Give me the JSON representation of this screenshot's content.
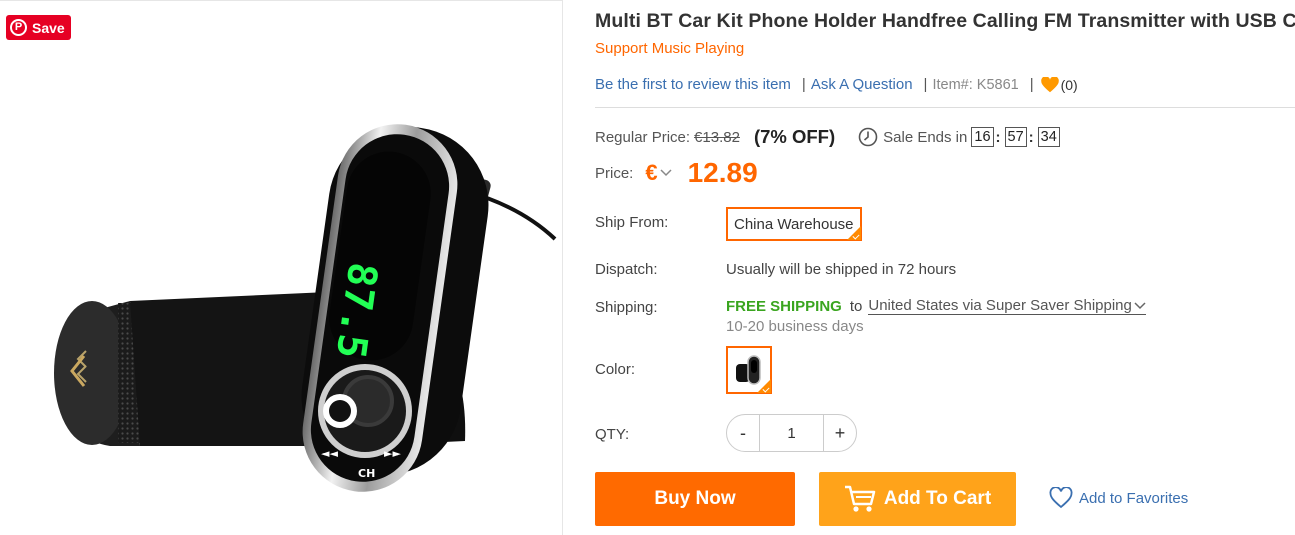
{
  "pinterest": {
    "save_label": "Save",
    "icon": "pinterest-icon"
  },
  "product": {
    "title": "Multi BT Car Kit Phone Holder Handfree Calling FM Transmitter with USB Charger",
    "subtitle": "Support Music Playing",
    "review_link": "Be the first to review this item",
    "ask_link": "Ask A Question",
    "item_number": "Item#: K5861",
    "favorites_count": "(0)",
    "display_digits": "87.5"
  },
  "pricing": {
    "regular_label": "Regular Price:",
    "regular_price": "€13.82",
    "discount": "(7% OFF)",
    "sale_label": "Sale Ends in",
    "timer": {
      "hours": "16",
      "minutes": "57",
      "seconds": "34"
    },
    "price_label": "Price:",
    "currency": "€",
    "price": "12.89"
  },
  "options": {
    "ship_from_label": "Ship From:",
    "ship_from_value": "China Warehouse",
    "dispatch_label": "Dispatch:",
    "dispatch_value": "Usually will be shipped in 72 hours",
    "shipping_label": "Shipping:",
    "free_shipping": "FREE SHIPPING",
    "to_text": "to",
    "shipping_destination": "United States via Super Saver Shipping",
    "shipping_days": "10-20 business days",
    "color_label": "Color:",
    "qty_label": "QTY:",
    "qty_minus": "-",
    "qty_value": "1",
    "qty_plus": "+"
  },
  "actions": {
    "buy_now": "Buy Now",
    "add_to_cart": "Add To Cart",
    "add_to_favorites": "Add to Favorites"
  },
  "colors": {
    "accent_orange": "#ff6600",
    "buy_now_bg": "#ff6a00",
    "add_cart_bg": "#ffa31a",
    "free_shipping_green": "#3aa51f",
    "link_blue": "#3a6fb0",
    "pinterest_red": "#e60023"
  }
}
